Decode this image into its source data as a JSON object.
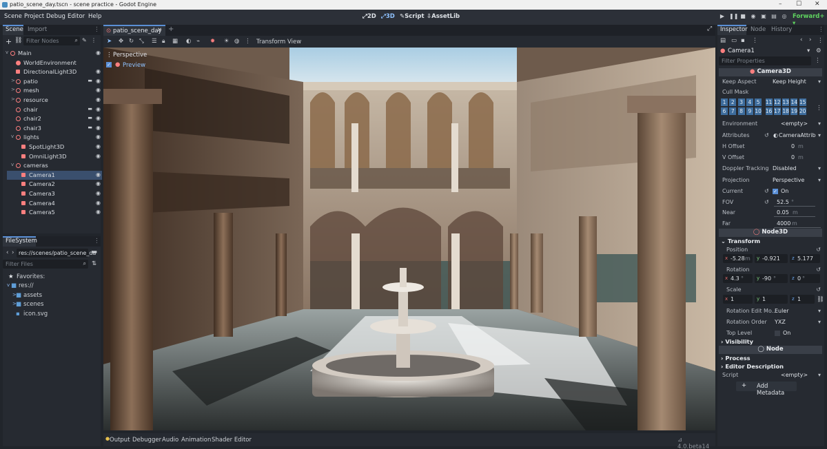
{
  "window": {
    "title": "patio_scene_day.tscn - scene practice - Godot Engine",
    "controls": [
      "–",
      "☐",
      "✕"
    ]
  },
  "menu": {
    "items": [
      "Scene",
      "Project",
      "Debug",
      "Editor",
      "Help"
    ],
    "workspaces": [
      {
        "label": "2D",
        "active": false
      },
      {
        "label": "3D",
        "active": true
      },
      {
        "label": "Script",
        "active": false
      },
      {
        "label": "AssetLib",
        "active": false
      }
    ],
    "renderer": "Forward+"
  },
  "scene_dock": {
    "tabs": [
      "Scene",
      "Import"
    ],
    "filter_placeholder": "Filter Nodes",
    "nodes": [
      {
        "label": "Main",
        "depth": 0,
        "kind": "node3d",
        "fold": "v",
        "eye": true,
        "cin": false,
        "selected": false
      },
      {
        "label": "WorldEnvironment",
        "depth": 1,
        "kind": "glob",
        "fold": "",
        "eye": false,
        "cin": false,
        "selected": false
      },
      {
        "label": "DirectionalLight3D",
        "depth": 1,
        "kind": "light",
        "fold": "",
        "eye": true,
        "cin": false,
        "selected": false
      },
      {
        "label": "patio",
        "depth": 1,
        "kind": "node3d",
        "fold": ">",
        "eye": true,
        "cin": true,
        "selected": false
      },
      {
        "label": "mesh",
        "depth": 1,
        "kind": "node3d",
        "fold": ">",
        "eye": true,
        "cin": false,
        "selected": false
      },
      {
        "label": "resource",
        "depth": 1,
        "kind": "node3d",
        "fold": ">",
        "eye": true,
        "cin": false,
        "selected": false
      },
      {
        "label": "chair",
        "depth": 1,
        "kind": "node3d",
        "fold": "",
        "eye": true,
        "cin": true,
        "selected": false
      },
      {
        "label": "chair2",
        "depth": 1,
        "kind": "node3d",
        "fold": "",
        "eye": true,
        "cin": true,
        "selected": false
      },
      {
        "label": "chair3",
        "depth": 1,
        "kind": "node3d",
        "fold": "",
        "eye": true,
        "cin": true,
        "selected": false
      },
      {
        "label": "lights",
        "depth": 1,
        "kind": "node3d",
        "fold": "v",
        "eye": true,
        "cin": false,
        "selected": false
      },
      {
        "label": "SpotLight3D",
        "depth": 2,
        "kind": "light",
        "fold": "",
        "eye": true,
        "cin": false,
        "selected": false
      },
      {
        "label": "OmniLight3D",
        "depth": 2,
        "kind": "light",
        "fold": "",
        "eye": true,
        "cin": false,
        "selected": false
      },
      {
        "label": "cameras",
        "depth": 1,
        "kind": "node3d",
        "fold": "v",
        "eye": false,
        "cin": false,
        "selected": false
      },
      {
        "label": "Camera1",
        "depth": 2,
        "kind": "camera",
        "fold": "",
        "eye": true,
        "cin": false,
        "selected": true
      },
      {
        "label": "Camera2",
        "depth": 2,
        "kind": "camera",
        "fold": "",
        "eye": true,
        "cin": false,
        "selected": false
      },
      {
        "label": "Camera3",
        "depth": 2,
        "kind": "camera",
        "fold": "",
        "eye": true,
        "cin": false,
        "selected": false
      },
      {
        "label": "Camera4",
        "depth": 2,
        "kind": "camera",
        "fold": "",
        "eye": true,
        "cin": false,
        "selected": false
      },
      {
        "label": "Camera5",
        "depth": 2,
        "kind": "camera",
        "fold": "",
        "eye": true,
        "cin": false,
        "selected": false
      }
    ]
  },
  "filesystem": {
    "tab": "FileSystem",
    "path": "res://scenes/patio_scene_da",
    "filter_placeholder": "Filter Files",
    "items": [
      {
        "label": "Favorites:",
        "depth": 0,
        "icon": "star"
      },
      {
        "label": "res://",
        "depth": 0,
        "icon": "folder"
      },
      {
        "label": "assets",
        "depth": 1,
        "icon": "folder"
      },
      {
        "label": "scenes",
        "depth": 1,
        "icon": "folder"
      },
      {
        "label": "icon.svg",
        "depth": 1,
        "icon": "file"
      }
    ]
  },
  "editor": {
    "scene_tab": "patio_scene_day",
    "toolbar_menus": [
      "Transform",
      "View"
    ],
    "viewport_label": "Perspective",
    "preview_label": "Preview"
  },
  "bottom": {
    "tabs": [
      "Output",
      "Debugger",
      "Audio",
      "Animation",
      "Shader Editor"
    ],
    "version": "4.0.beta14"
  },
  "inspector": {
    "tabs": [
      "Inspector",
      "Node",
      "History"
    ],
    "object_name": "Camera1",
    "filter_placeholder": "Filter Properties",
    "class_header": "Camera3D",
    "keep_aspect": {
      "label": "Keep Aspect",
      "value": "Keep Height"
    },
    "cull_mask": {
      "label": "Cull Mask",
      "row1": [
        "1",
        "2",
        "3",
        "4",
        "5",
        "11",
        "12",
        "13",
        "14",
        "15"
      ],
      "row2": [
        "6",
        "7",
        "8",
        "9",
        "10",
        "16",
        "17",
        "18",
        "19",
        "20"
      ]
    },
    "environment": {
      "label": "Environment",
      "value": "<empty>"
    },
    "attributes": {
      "label": "Attributes",
      "value": "CameraAttrib"
    },
    "h_offset": {
      "label": "H Offset",
      "value": "0",
      "unit": "m"
    },
    "v_offset": {
      "label": "V Offset",
      "value": "0",
      "unit": "m"
    },
    "doppler": {
      "label": "Doppler Tracking",
      "value": "Disabled"
    },
    "projection": {
      "label": "Projection",
      "value": "Perspective"
    },
    "current": {
      "label": "Current",
      "value": "On"
    },
    "fov": {
      "label": "FOV",
      "value": "52.5",
      "unit": "°"
    },
    "near": {
      "label": "Near",
      "value": "0.05",
      "unit": "m"
    },
    "far": {
      "label": "Far",
      "value": "4000",
      "unit": "m"
    },
    "node3d_header": "Node3D",
    "transform_header": "Transform",
    "position": {
      "label": "Position",
      "x": "-5.28",
      "y": "-0.921",
      "z": "5.177",
      "unit": "m"
    },
    "rotation": {
      "label": "Rotation",
      "x": "4.3",
      "y": "-90",
      "z": "0",
      "unit": "°"
    },
    "scale": {
      "label": "Scale",
      "x": "1",
      "y": "1",
      "z": "1"
    },
    "rotation_mode": {
      "label": "Rotation Edit Mo...",
      "value": "Euler"
    },
    "rotation_order": {
      "label": "Rotation Order",
      "value": "YXZ"
    },
    "top_level": {
      "label": "Top Level",
      "value": "On"
    },
    "visibility_header": "Visibility",
    "node_header": "Node",
    "process_header": "Process",
    "editor_desc_header": "Editor Description",
    "script": {
      "label": "Script",
      "value": "<empty>"
    },
    "add_metadata": "Add Metadata"
  },
  "colors": {
    "accent": "#5a8fd6",
    "node3d": "#fc7f7f",
    "renderer": "#5fd35f",
    "selected": "#3a4f6d"
  }
}
